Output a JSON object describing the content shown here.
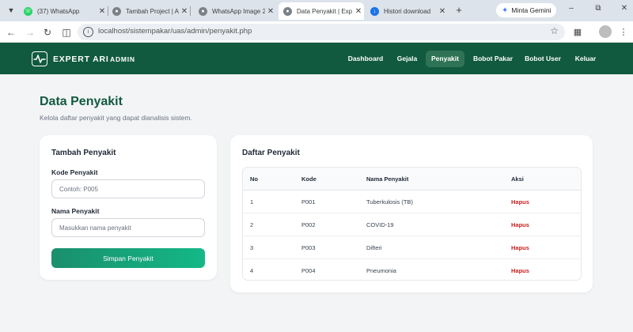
{
  "browser": {
    "tabs": [
      {
        "title": "(37) WhatsApp",
        "active": false
      },
      {
        "title": "Tambah Project | Ad",
        "active": false
      },
      {
        "title": "WhatsApp Image 20",
        "active": false
      },
      {
        "title": "Data Penyakit | Exp",
        "active": true
      },
      {
        "title": "Histori download",
        "active": false
      }
    ],
    "new_tab_icon": "+",
    "gemini_label": "Minta Gemini",
    "url": "localhost/sistempakar/uas/admin/penyakit.php"
  },
  "app": {
    "brand": "EXPERT ARI",
    "brand_sub": "ADMIN",
    "nav": [
      {
        "label": "Dashboard",
        "active": false
      },
      {
        "label": "Gejala",
        "active": false
      },
      {
        "label": "Penyakit",
        "active": true
      },
      {
        "label": "Bobot Pakar",
        "active": false
      },
      {
        "label": "Bobot User",
        "active": false
      },
      {
        "label": "Keluar",
        "active": false
      }
    ],
    "colors": {
      "header": "#115a3f",
      "accent": "#14b887",
      "danger": "#c81e1e"
    }
  },
  "page": {
    "title": "Data Penyakit",
    "subtitle": "Kelola daftar penyakit yang dapat dianalisis sistem."
  },
  "form": {
    "title": "Tambah Penyakit",
    "code_label": "Kode Penyakit",
    "code_placeholder": "Contoh: P005",
    "code_value": "",
    "name_label": "Nama Penyakit",
    "name_placeholder": "Masukkan nama penyakit",
    "name_value": "",
    "submit_label": "Simpan Penyakit"
  },
  "list": {
    "title": "Daftar Penyakit",
    "columns": [
      "No",
      "Kode",
      "Nama Penyakit",
      "Aksi"
    ],
    "rows": [
      {
        "no": "1",
        "kode": "P001",
        "nama": "Tuberkulosis (TB)",
        "aksi": "Hapus"
      },
      {
        "no": "2",
        "kode": "P002",
        "nama": "COVID-19",
        "aksi": "Hapus"
      },
      {
        "no": "3",
        "kode": "P003",
        "nama": "Difteri",
        "aksi": "Hapus"
      },
      {
        "no": "4",
        "kode": "P004",
        "nama": "Pneumonia",
        "aksi": "Hapus"
      }
    ]
  }
}
